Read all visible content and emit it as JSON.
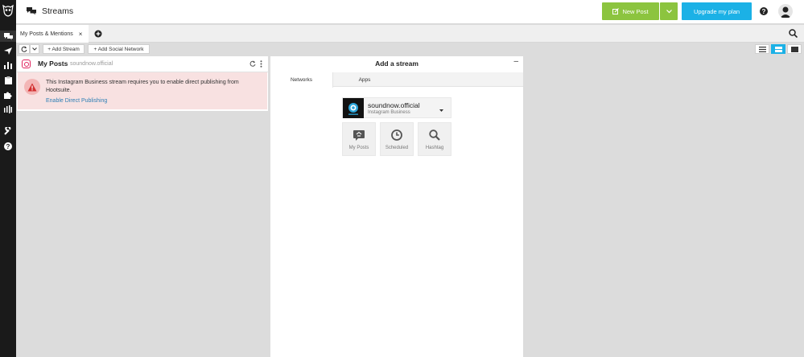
{
  "header": {
    "title": "Streams",
    "new_post_label": "New Post",
    "upgrade_label": "Upgrade my plan"
  },
  "tabs": [
    {
      "label": "My Posts & Mentions",
      "close": "×"
    }
  ],
  "toolbar": {
    "add_stream_label": "+ Add Stream",
    "add_social_label": "+ Add Social Network"
  },
  "stream": {
    "title": "My Posts",
    "account": "soundnow.official",
    "alert_text": "This Instagram Business stream requires you to enable direct publishing from Hootsuite.",
    "alert_link": "Enable Direct Publishing"
  },
  "add_stream_panel": {
    "title": "Add a stream",
    "minimize": "–",
    "tabs": [
      "Networks",
      "Apps"
    ],
    "account_name": "soundnow.official",
    "account_type": "Instagram Business",
    "stream_types": [
      {
        "label": "My Posts",
        "icon": "speech-bubble-icon"
      },
      {
        "label": "Scheduled",
        "icon": "clock-icon"
      },
      {
        "label": "Hashtag",
        "icon": "magnifier-icon"
      }
    ]
  },
  "colors": {
    "new_post": "#8cc43f",
    "upgrade": "#1bb1e6",
    "alert_bg": "#f8e1e1",
    "link": "#2d7fb5",
    "rail": "#1a1a1a"
  }
}
